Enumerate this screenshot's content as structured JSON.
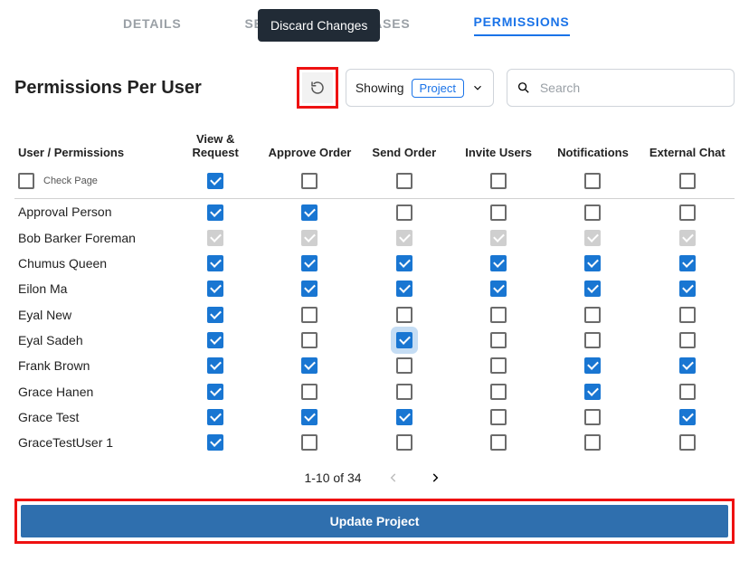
{
  "tabs": {
    "details": "DETAILS",
    "setup": "SETUP",
    "phases": "PHASES",
    "permissions": "PERMISSIONS",
    "active": "permissions"
  },
  "tooltip": "Discard Changes",
  "title": "Permissions Per User",
  "showing": {
    "label": "Showing",
    "value": "Project"
  },
  "search": {
    "placeholder": "Search"
  },
  "columns": {
    "user": "User / Permissions",
    "view": "View & Request",
    "approve": "Approve Order",
    "send": "Send Order",
    "invite": "Invite Users",
    "notif": "Notifications",
    "ext": "External Chat"
  },
  "checkpage": {
    "label": "Check Page",
    "cells": [
      "checked",
      "empty",
      "empty",
      "empty",
      "empty",
      "empty"
    ]
  },
  "rows": [
    {
      "name": "Approval Person",
      "cells": [
        "checked",
        "checked",
        "empty",
        "empty",
        "empty",
        "empty"
      ]
    },
    {
      "name": "Bob Barker Foreman",
      "cells": [
        "disabled",
        "disabled",
        "disabled",
        "disabled",
        "disabled",
        "disabled"
      ]
    },
    {
      "name": "Chumus Queen",
      "cells": [
        "checked",
        "checked",
        "checked",
        "checked",
        "checked",
        "checked"
      ]
    },
    {
      "name": "Eilon Ma",
      "cells": [
        "checked",
        "checked",
        "checked",
        "checked",
        "checked",
        "checked"
      ]
    },
    {
      "name": "Eyal New",
      "cells": [
        "checked",
        "empty",
        "empty",
        "empty",
        "empty",
        "empty"
      ]
    },
    {
      "name": "Eyal Sadeh",
      "cells": [
        "checked",
        "empty",
        "checked-halo",
        "empty",
        "empty",
        "empty"
      ]
    },
    {
      "name": "Frank Brown",
      "cells": [
        "checked",
        "checked",
        "empty",
        "empty",
        "checked",
        "checked"
      ]
    },
    {
      "name": "Grace Hanen",
      "cells": [
        "checked",
        "empty",
        "empty",
        "empty",
        "checked",
        "empty"
      ]
    },
    {
      "name": "Grace Test",
      "cells": [
        "checked",
        "checked",
        "checked",
        "empty",
        "empty",
        "checked"
      ]
    },
    {
      "name": "GraceTestUser 1",
      "cells": [
        "checked",
        "empty",
        "empty",
        "empty",
        "empty",
        "empty"
      ]
    }
  ],
  "pager": {
    "text": "1-10 of 34"
  },
  "update": "Update Project"
}
